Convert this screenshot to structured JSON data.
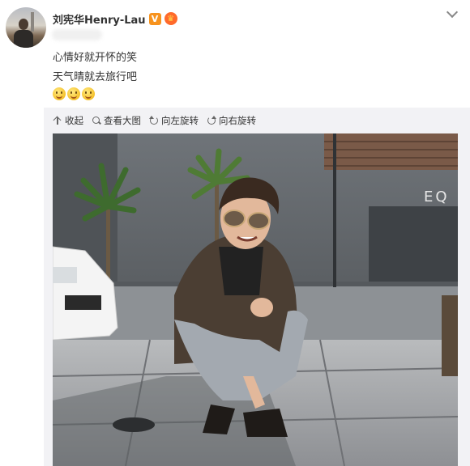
{
  "user": {
    "name": "刘宪华Henry-Lau",
    "verified_badge": "V",
    "crown_badge": "crown-icon"
  },
  "post": {
    "lines": [
      "心情好就开怀的笑",
      "天气晴就去旅行吧"
    ],
    "emoji_count": 3
  },
  "toolbar": {
    "collapse": "收起",
    "view_large": "查看大图",
    "rotate_left": "向左旋转",
    "rotate_right": "向右旋转"
  },
  "photo": {
    "storefront_text": "EQ"
  },
  "colors": {
    "verified_orange": "#f7931e",
    "media_bg": "#f2f2f5",
    "text": "#333333"
  }
}
